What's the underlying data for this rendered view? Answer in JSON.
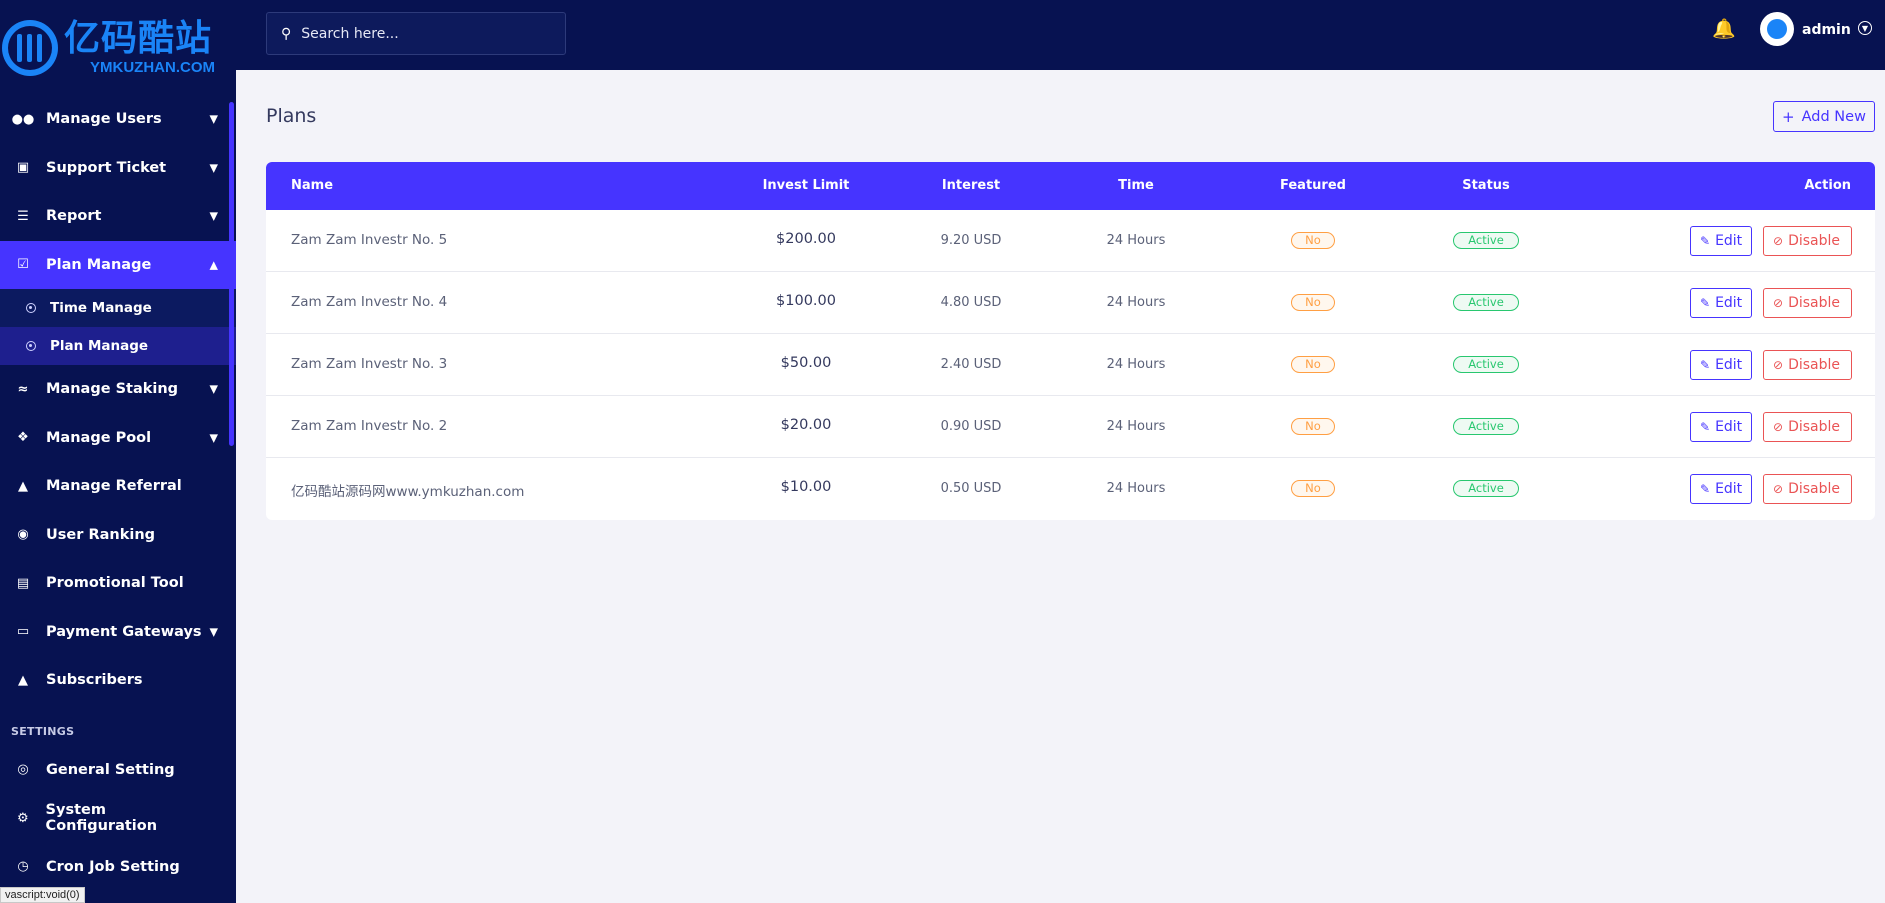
{
  "brand": {
    "logo_cn": "亿码酷站",
    "logo_en": "YMKUZHAN.COM"
  },
  "topbar": {
    "search_placeholder": "Search here...",
    "user_name": "admin"
  },
  "sidebar": {
    "items": [
      {
        "label": "Manage Users",
        "icon": "users-icon",
        "has_children": true
      },
      {
        "label": "Support Ticket",
        "icon": "ticket-icon",
        "has_children": true
      },
      {
        "label": "Report",
        "icon": "list-icon",
        "has_children": true
      },
      {
        "label": "Plan Manage",
        "icon": "clipboard-icon",
        "has_children": true,
        "active": true,
        "expanded": true
      },
      {
        "label": "Manage Staking",
        "icon": "chart-line-icon",
        "has_children": true
      },
      {
        "label": "Manage Pool",
        "icon": "cubes-icon",
        "has_children": true
      },
      {
        "label": "Manage Referral",
        "icon": "tree-icon",
        "has_children": false
      },
      {
        "label": "User Ranking",
        "icon": "medal-icon",
        "has_children": false
      },
      {
        "label": "Promotional Tool",
        "icon": "ad-icon",
        "has_children": false
      },
      {
        "label": "Payment Gateways",
        "icon": "credit-card-icon",
        "has_children": true
      },
      {
        "label": "Subscribers",
        "icon": "thumbs-up-icon",
        "has_children": false
      }
    ],
    "submenu": [
      {
        "label": "Time Manage",
        "active": false
      },
      {
        "label": "Plan Manage",
        "active": true
      }
    ],
    "settings_label": "SETTINGS",
    "settings_items": [
      {
        "label": "General Setting",
        "icon": "life-ring-icon"
      },
      {
        "label": "System Configuration",
        "icon": "gear-icon"
      },
      {
        "label": "Cron Job Setting",
        "icon": "clock-icon"
      }
    ],
    "status_tip": "vascript:void(0)"
  },
  "page": {
    "title": "Plans",
    "add_label": "Add New"
  },
  "table": {
    "headers": {
      "name": "Name",
      "limit": "Invest Limit",
      "interest": "Interest",
      "time": "Time",
      "featured": "Featured",
      "status": "Status",
      "action": "Action"
    },
    "edit_label": "Edit",
    "disable_label": "Disable",
    "rows": [
      {
        "name": "Zam Zam Investr No. 5",
        "limit": "$200.00",
        "interest": "9.20 USD",
        "time": "24 Hours",
        "featured": "No",
        "status": "Active"
      },
      {
        "name": "Zam Zam Investr No. 4",
        "limit": "$100.00",
        "interest": "4.80 USD",
        "time": "24 Hours",
        "featured": "No",
        "status": "Active"
      },
      {
        "name": "Zam Zam Investr No. 3",
        "limit": "$50.00",
        "interest": "2.40 USD",
        "time": "24 Hours",
        "featured": "No",
        "status": "Active"
      },
      {
        "name": "Zam Zam Investr No. 2",
        "limit": "$20.00",
        "interest": "0.90 USD",
        "time": "24 Hours",
        "featured": "No",
        "status": "Active"
      },
      {
        "name": "亿码酷站源码网www.ymkuzhan.com",
        "limit": "$10.00",
        "interest": "0.50 USD",
        "time": "24 Hours",
        "featured": "No",
        "status": "Active"
      }
    ]
  },
  "colors": {
    "sidebar_bg": "#071251",
    "accent": "#4634ff",
    "warning": "#ff9f43",
    "success": "#28c76f",
    "danger": "#ea5455"
  }
}
